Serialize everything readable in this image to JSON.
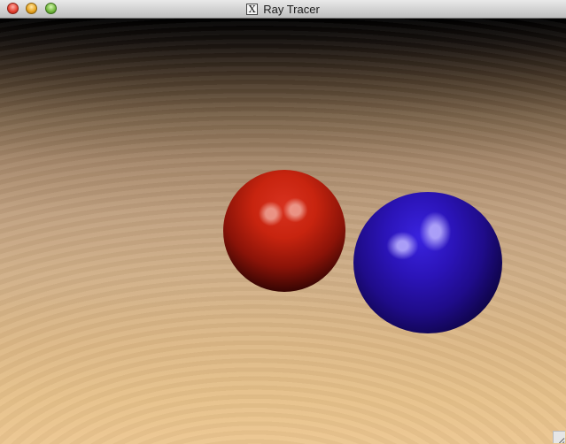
{
  "window": {
    "title": "Ray Tracer",
    "title_icon": "x11-icon",
    "title_icon_glyph": "X"
  },
  "scene": {
    "background_colors": {
      "top": "#000000",
      "bottom": "#ecc690"
    },
    "spheres": [
      {
        "name": "red-sphere",
        "color": "#c8240f"
      },
      {
        "name": "blue-sphere",
        "color": "#2b14b8"
      }
    ]
  }
}
